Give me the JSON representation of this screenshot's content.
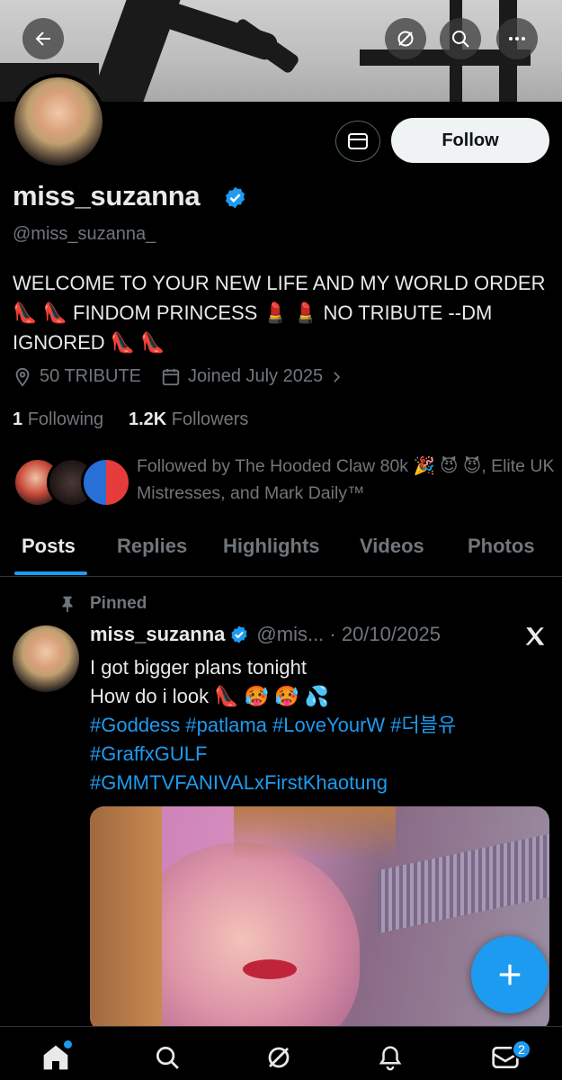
{
  "profile": {
    "name": "miss_suzanna",
    "handle": "@miss_suzanna_",
    "bio": "WELCOME TO YOUR NEW LIFE AND MY WORLD ORDER 👠 👠 FINDOM PRINCESS 💄 💄 NO TRIBUTE --DM IGNORED 👠 👠",
    "location": "50 TRIBUTE",
    "joined": "Joined July 2025",
    "following_count": "1",
    "following_label": "Following",
    "followers_count": "1.2K",
    "followers_label": "Followers",
    "followed_by": "Followed by The Hooded Claw 80k 🎉 😈 😈, Elite UK Mistresses, and Mark Daily™"
  },
  "actions": {
    "follow_label": "Follow"
  },
  "tabs": [
    {
      "label": "Posts",
      "active": true
    },
    {
      "label": "Replies"
    },
    {
      "label": "Highlights"
    },
    {
      "label": "Videos"
    },
    {
      "label": "Photos"
    }
  ],
  "post": {
    "pinned_label": "Pinned",
    "author_name": "miss_suzanna",
    "author_handle_date": "@mis... · 20/10/2025",
    "line1": "I got bigger plans tonight",
    "line2": "How do i look 👠 🥵 🥵 💦",
    "hashtags_line1": "#Goddess #patlama #LoveYourW #더블유",
    "hashtags_line2": "#GraffxGULF",
    "hashtags_line3": "#GMMTVFANIVALxFirstKhaotung"
  },
  "nav": {
    "messages_badge": "2"
  },
  "icons": [
    "back-arrow-icon",
    "grok-icon",
    "search-icon",
    "more-icon",
    "mail-icon",
    "verified-icon",
    "location-icon",
    "calendar-icon",
    "chevron-right-icon",
    "pin-icon",
    "x-logo-icon",
    "plus-icon",
    "home-icon",
    "notifications-icon",
    "messages-icon"
  ],
  "colors": {
    "accent": "#1d9bf0",
    "background": "#000000",
    "text_primary": "#e7e9ea",
    "text_secondary": "#71767b"
  }
}
